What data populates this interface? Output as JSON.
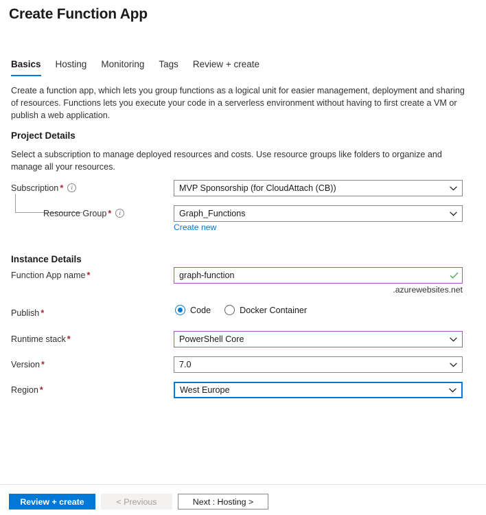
{
  "page": {
    "title": "Create Function App"
  },
  "tabs": [
    {
      "label": "Basics",
      "active": true
    },
    {
      "label": "Hosting",
      "active": false
    },
    {
      "label": "Monitoring",
      "active": false
    },
    {
      "label": "Tags",
      "active": false
    },
    {
      "label": "Review + create",
      "active": false
    }
  ],
  "intro": "Create a function app, which lets you group functions as a logical unit for easier management, deployment and sharing of resources. Functions lets you execute your code in a serverless environment without having to first create a VM or publish a web application.",
  "project_details": {
    "title": "Project Details",
    "description": "Select a subscription to manage deployed resources and costs. Use resource groups like folders to organize and manage all your resources.",
    "subscription": {
      "label": "Subscription",
      "required": "*",
      "info_icon": "info-icon",
      "value": "MVP Sponsorship (for CloudAttach (CB))",
      "chevron_icon": "chevron-down-icon"
    },
    "resource_group": {
      "label": "Resource Group",
      "required": "*",
      "info_icon": "info-icon",
      "value": "Graph_Functions",
      "chevron_icon": "chevron-down-icon",
      "create_new_link": "Create new"
    }
  },
  "instance_details": {
    "title": "Instance Details",
    "function_app_name": {
      "label": "Function App name",
      "required": "*",
      "value": "graph-function",
      "valid_icon": "checkmark-icon",
      "suffix": ".azurewebsites.net"
    },
    "publish": {
      "label": "Publish",
      "required": "*",
      "options": [
        {
          "label": "Code",
          "selected": true
        },
        {
          "label": "Docker Container",
          "selected": false
        }
      ]
    },
    "runtime_stack": {
      "label": "Runtime stack",
      "required": "*",
      "value": "PowerShell Core",
      "chevron_icon": "chevron-down-icon"
    },
    "version": {
      "label": "Version",
      "required": "*",
      "value": "7.0",
      "chevron_icon": "chevron-down-icon"
    },
    "region": {
      "label": "Region",
      "required": "*",
      "value": "West Europe",
      "chevron_icon": "chevron-down-icon"
    }
  },
  "footer": {
    "review_create": "Review + create",
    "previous": "< Previous",
    "next": "Next : Hosting >"
  },
  "colors": {
    "accent_blue": "#0078d4",
    "required_red": "#a4262c",
    "validated_purple": "#a457b9",
    "success_green": "#4caf50",
    "link_blue": "#0078d4",
    "border_gray": "#8a8886"
  }
}
